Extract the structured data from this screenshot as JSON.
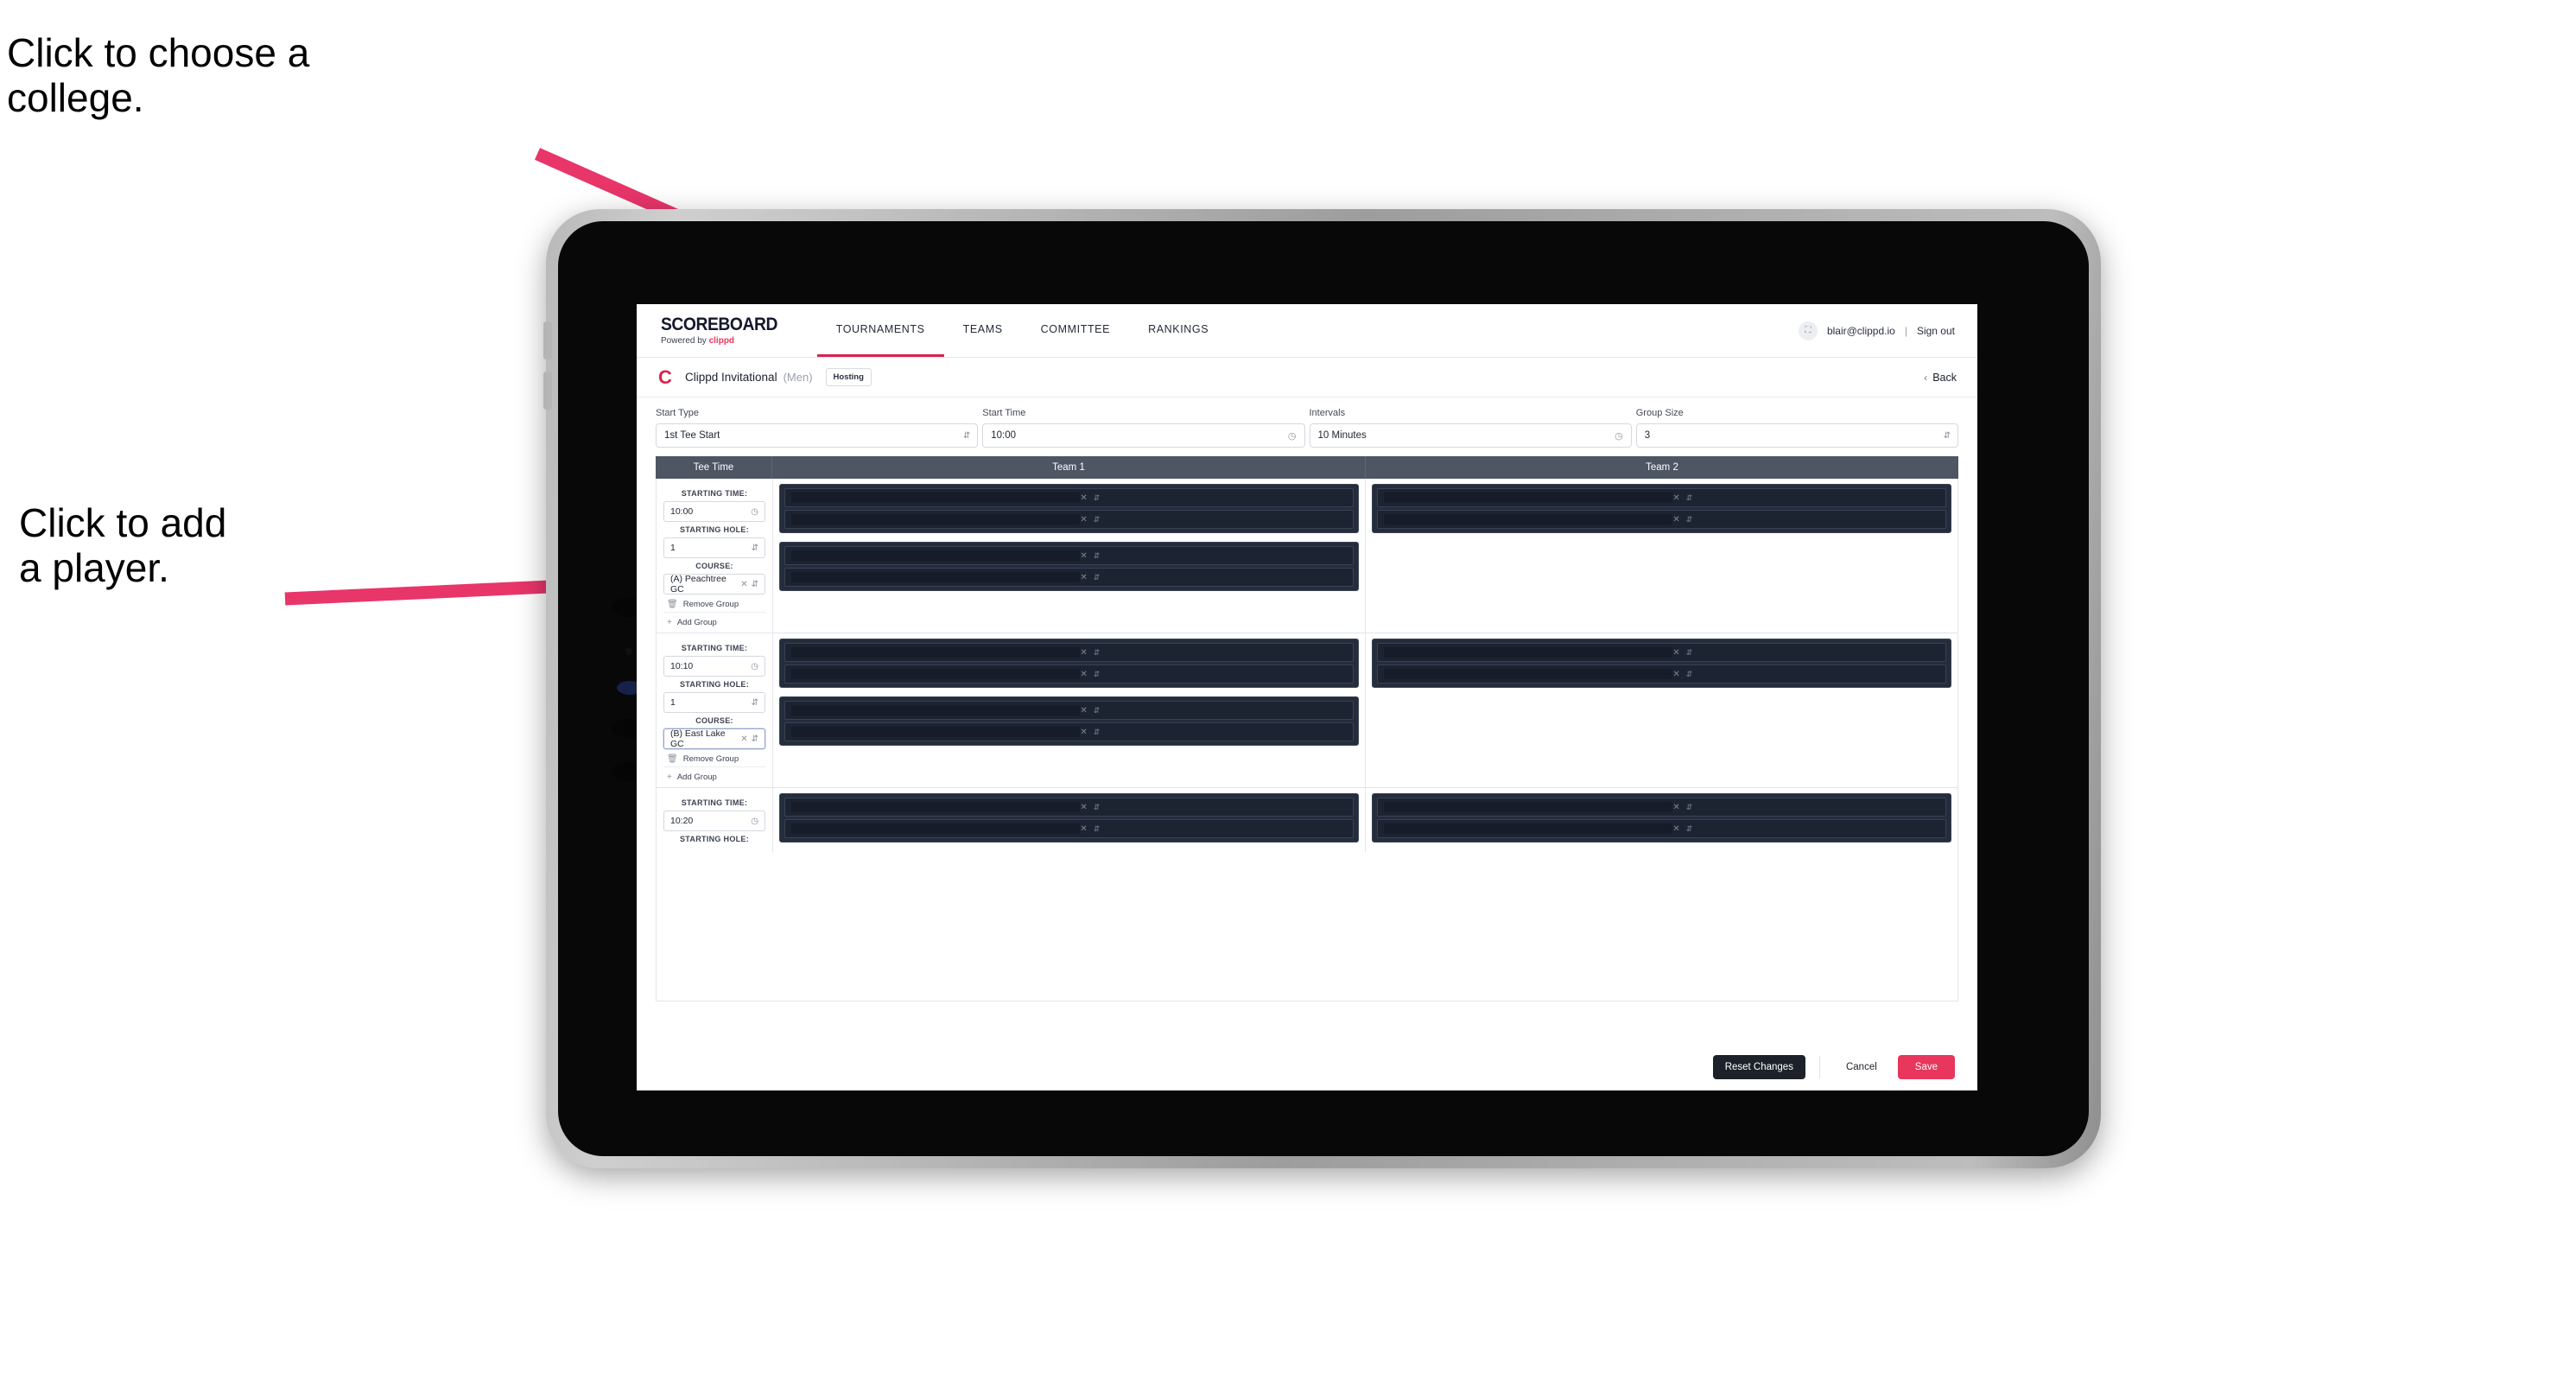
{
  "annotations": {
    "college": "Click to choose a\ncollege.",
    "player": "Click to add\na player.",
    "arrow_color": "#e8356a"
  },
  "app": {
    "topnav": {
      "brand_title": "SCOREBOARD",
      "brand_sub_prefix": "Powered by ",
      "brand_sub_name": "clippd",
      "tabs": [
        {
          "label": "TOURNAMENTS",
          "active": true
        },
        {
          "label": "TEAMS",
          "active": false
        },
        {
          "label": "COMMITTEE",
          "active": false
        },
        {
          "label": "RANKINGS",
          "active": false
        }
      ],
      "account": {
        "avatar_icon": "user-image-icon",
        "email": "blair@clippd.io",
        "separator": "|",
        "signout": "Sign out"
      }
    },
    "tournament_bar": {
      "logo_letter": "C",
      "name": "Clippd Invitational",
      "gender": "(Men)",
      "hosting_badge": "Hosting",
      "back_chevron": "‹",
      "back_label": "Back"
    },
    "settings": [
      {
        "label": "Start Type",
        "value": "1st Tee Start",
        "icon": "stepper-icon"
      },
      {
        "label": "Start Time",
        "value": "10:00",
        "icon": "clock-icon"
      },
      {
        "label": "Intervals",
        "value": "10 Minutes",
        "icon": "clock-icon"
      },
      {
        "label": "Group Size",
        "value": "3",
        "icon": "stepper-icon"
      }
    ],
    "table": {
      "headers": [
        "Tee Time",
        "Team 1",
        "Team 2"
      ],
      "field_labels": {
        "starting_time": "STARTING TIME:",
        "starting_hole": "STARTING HOLE:",
        "course": "COURSE:"
      },
      "actions": {
        "remove_group": "Remove Group",
        "add_group": "Add Group",
        "remove_icon": "trash-icon",
        "add_icon": "plus-icon"
      },
      "rows": [
        {
          "starting_time": "10:00",
          "starting_hole": "1",
          "course": "(A) Peachtree GC",
          "course_focused": false,
          "team1_boxes": [
            2,
            2
          ],
          "team2_boxes": [
            2
          ]
        },
        {
          "starting_time": "10:10",
          "starting_hole": "1",
          "course": "(B) East Lake GC",
          "course_focused": true,
          "team1_boxes": [
            2,
            2
          ],
          "team2_boxes": [
            2
          ]
        },
        {
          "starting_time": "10:20",
          "starting_hole": "",
          "course": "",
          "course_focused": false,
          "team1_boxes": [
            2
          ],
          "team2_boxes": [
            2
          ]
        }
      ],
      "row_icons": {
        "clear_icon": "x-icon",
        "stepper_icon": "stepper-icon"
      }
    },
    "footer": {
      "reset": "Reset Changes",
      "cancel": "Cancel",
      "save": "Save"
    },
    "colors": {
      "accent_pink": "#e8365d",
      "brand_red": "#d9234f",
      "header_slate": "#4e5664",
      "dark_panel": "#252c3b"
    }
  }
}
